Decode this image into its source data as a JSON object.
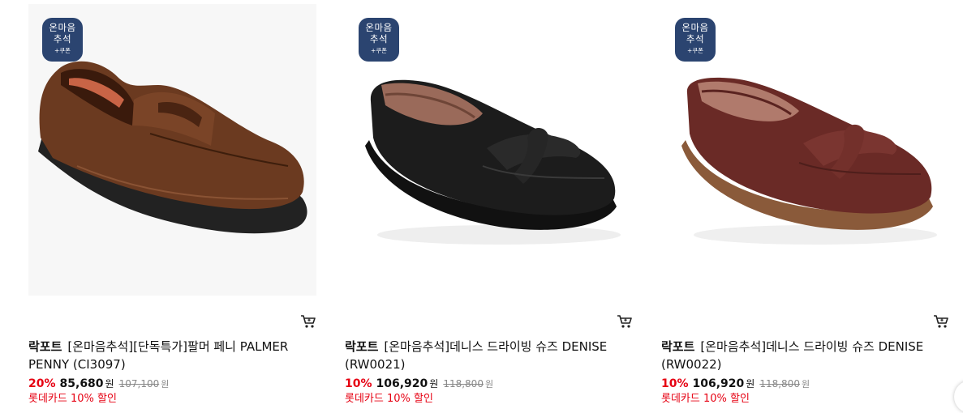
{
  "badge": {
    "line1": "온마음",
    "line2": "추석",
    "line3": "+쿠폰"
  },
  "products": [
    {
      "brand": "락포트",
      "name": "[온마음추석][단독특가]팔머 페니 PALMER PENNY (CI3097)",
      "discount": "20%",
      "price": "85,680",
      "currency": "원",
      "original_price": "107,100",
      "original_currency": "원",
      "card_discount": "롯데카드 10% 할인",
      "image_icon": "brown-penny-loafer-image"
    },
    {
      "brand": "락포트",
      "name": "[온마음추석]데니스 드라이빙 슈즈 DENISE (RW0021)",
      "discount": "10%",
      "price": "106,920",
      "currency": "원",
      "original_price": "118,800",
      "original_currency": "원",
      "card_discount": "롯데카드 10% 할인",
      "image_icon": "black-bow-loafer-image"
    },
    {
      "brand": "락포트",
      "name": "[온마음추석]데니스 드라이빙 슈즈 DENISE (RW0022)",
      "discount": "10%",
      "price": "106,920",
      "currency": "원",
      "original_price": "118,800",
      "original_currency": "원",
      "card_discount": "롯데카드 10% 할인",
      "image_icon": "burgundy-bow-loafer-image"
    }
  ],
  "colors": {
    "badge_bg": "#2b4470",
    "discount_red": "#e60012",
    "shoe_brown": "#6b3a20",
    "shoe_black": "#1c1c1c",
    "shoe_burgundy": "#6a2a26"
  },
  "icons": {
    "cart": "shopping-cart-icon"
  }
}
